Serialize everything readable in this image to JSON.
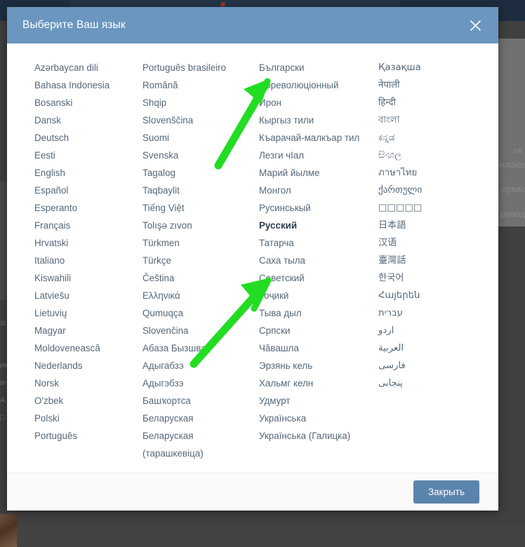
{
  "modal": {
    "title": "Выберите Ваш язык",
    "close_icon": "close-icon",
    "footer_button": "Закрыть",
    "columns": [
      {
        "id": "column-1",
        "items": [
          "Azərbaycan dili",
          "Bahasa Indonesia",
          "Bosanski",
          "Dansk",
          "Deutsch",
          "Eesti",
          "English",
          "Español",
          "Esperanto",
          "Français",
          "Hrvatski",
          "Italiano",
          "Kiswahili",
          "Latviešu",
          "Lietuvių",
          "Magyar",
          "Moldovenească",
          "Nederlands",
          "Norsk",
          "O'zbek",
          "Polski",
          "Português"
        ]
      },
      {
        "id": "column-2",
        "items": [
          "Português brasileiro",
          "Română",
          "Shqip",
          "Slovenščina",
          "Suomi",
          "Svenska",
          "Tagalog",
          "Taqbaylit",
          "Tiếng Việt",
          "Tolışə zıvon",
          "Türkmen",
          "Türkçe",
          "Čeština",
          "Ελληνικά",
          "Qumuqça",
          "Slovenčina",
          "Абаза Бызшва",
          "Адыгабзэ",
          "Адыгэбзэ",
          "Башҡортса",
          "Беларуская",
          "Беларуская\n(тарашкевіца)"
        ]
      },
      {
        "id": "column-3",
        "items": [
          "Български",
          "Дореволюціонный",
          "Ирон",
          "Кыргыз тили",
          "Къарачай-малкъар тил",
          "Лезги чӀал",
          "Марий йылме",
          "Монгол",
          "Русинськый",
          "Русский",
          "Татарча",
          "Саха тыла",
          "Советский",
          "Тоҷикӣ",
          "Тыва дыл",
          "Српски",
          "Чăвашла",
          "Эрзянь кель",
          "Хальмг келн",
          "Удмурт",
          "Українська",
          "Українська (Галицка)"
        ],
        "selected": "Русский"
      },
      {
        "id": "column-4",
        "items": [
          "Қазақша",
          "नेपाली",
          "हिन्दी",
          "বাংলা",
          "ಕನ್ನಡ",
          "සිංහල",
          "ภาษาไทย",
          "ქართული",
          "□□□□□",
          "日本語",
          "汉语",
          "臺灣話",
          "한국어",
          "Հայերեն",
          "עברית",
          "اردو",
          "العربية",
          "فارسی",
          "پنجابی"
        ]
      }
    ]
  },
  "annotations": {
    "arrow_color": "#22dd22",
    "arrows": [
      {
        "name": "arrow-to-dorevolucionnyj",
        "target_label": "Дореволюціонный"
      },
      {
        "name": "arrow-to-sovetskiy",
        "target_label": "Советский"
      }
    ]
  },
  "background": {
    "right_fragments": [
      "ок",
      "риложе",
      "ервис",
      "ревод"
    ],
    "left_fragments": [
      "st",
      "ик",
      "ин",
      "А.",
      "□"
    ]
  },
  "colors": {
    "header": "#6b96bf",
    "button": "#5b84ad",
    "link": "#55687a",
    "backdrop": "#434343"
  }
}
